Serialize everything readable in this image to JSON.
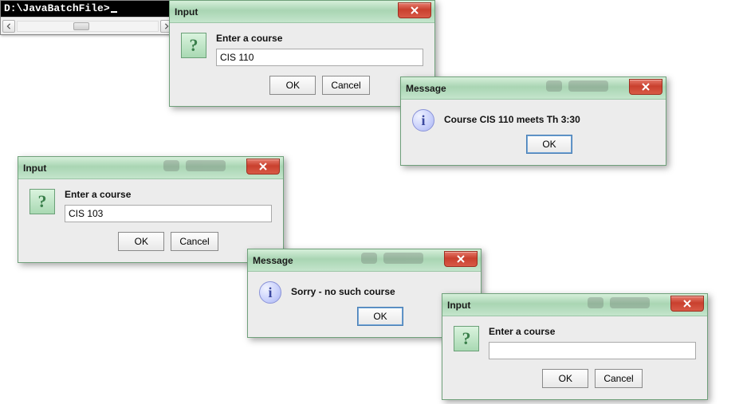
{
  "console": {
    "prompt": "D:\\JavaBatchFile>"
  },
  "dialogs": {
    "input1": {
      "title": "Input",
      "prompt": "Enter a course",
      "value": "CIS 110",
      "ok": "OK",
      "cancel": "Cancel"
    },
    "message1": {
      "title": "Message",
      "text": "Course CIS 110 meets Th 3:30",
      "ok": "OK"
    },
    "input2": {
      "title": "Input",
      "prompt": "Enter a course",
      "value": "CIS 103",
      "ok": "OK",
      "cancel": "Cancel"
    },
    "message2": {
      "title": "Message",
      "text": "Sorry - no such course",
      "ok": "OK"
    },
    "input3": {
      "title": "Input",
      "prompt": "Enter a course",
      "value": "",
      "ok": "OK",
      "cancel": "Cancel"
    }
  }
}
